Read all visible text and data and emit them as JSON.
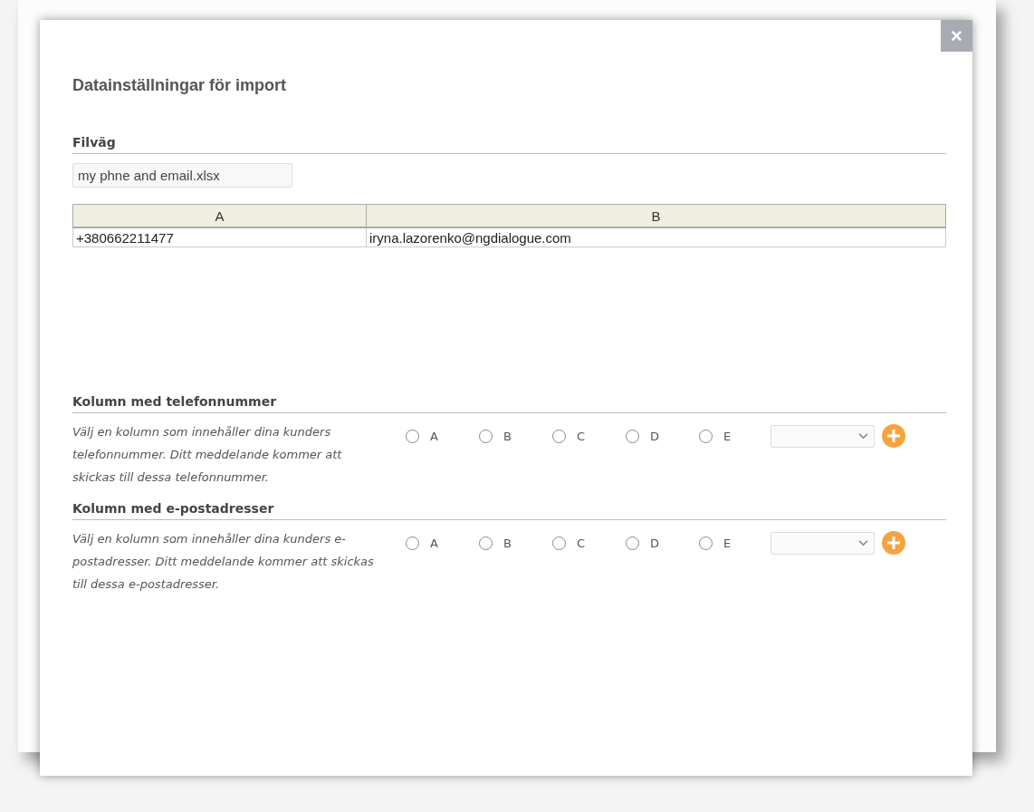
{
  "dialog": {
    "title": "Datainställningar för import",
    "close": "×"
  },
  "file_path": {
    "label": "Filväg",
    "value": "my phne and email.xlsx"
  },
  "preview_table": {
    "columns": [
      "A",
      "B"
    ],
    "rows": [
      [
        "+380662211477",
        "iryna.lazorenko@ngdialogue.com"
      ]
    ]
  },
  "mappings": [
    {
      "title": "Kolumn med telefonnummer",
      "description": "Välj en kolumn som innehåller dina kunders telefonnummer. Ditt meddelande kommer att skickas till dessa telefonnummer.",
      "options": [
        {
          "label": "A",
          "selected": false
        },
        {
          "label": "B",
          "selected": false
        },
        {
          "label": "C",
          "selected": false
        },
        {
          "label": "D",
          "selected": false
        },
        {
          "label": "E",
          "selected": false
        }
      ]
    },
    {
      "title": "Kolumn med e-postadresser",
      "description": "Välj en kolumn som innehåller dina kunders e-postadresser. Ditt meddelande kommer att skickas till dessa e-postadresser.",
      "options": [
        {
          "label": "A",
          "selected": false
        },
        {
          "label": "B",
          "selected": false
        },
        {
          "label": "C",
          "selected": false
        },
        {
          "label": "D",
          "selected": false
        },
        {
          "label": "E",
          "selected": false
        }
      ]
    }
  ]
}
